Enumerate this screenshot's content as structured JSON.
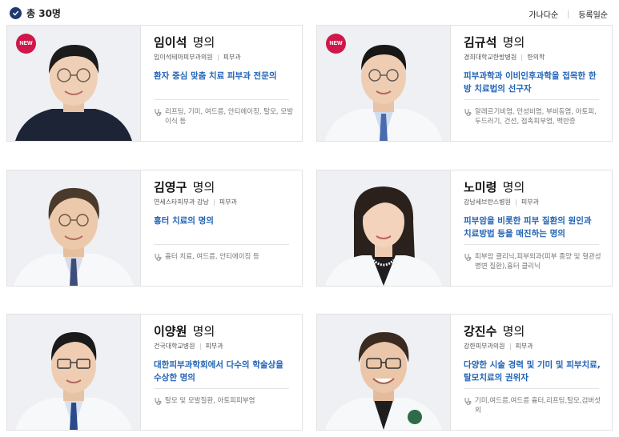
{
  "header": {
    "total_label": "총 30명",
    "sort_options": [
      "가나다순",
      "등록일순"
    ]
  },
  "doctors": [
    {
      "name": "임이석",
      "title": "명의",
      "is_new": true,
      "badge": "NEW",
      "hospital": "임이석테마피부과의원",
      "department": "피부과",
      "headline": "환자 중심 맞춤 치료 피부과 전문의",
      "specialties": "리프팅, 기미, 여드름, 안티에이징, 탈모, 모발이식 등"
    },
    {
      "name": "김규석",
      "title": "명의",
      "is_new": true,
      "badge": "NEW",
      "hospital": "경희대학교한방병원",
      "department": "한의학",
      "headline": "피부과학과 이비인후과학을 접목한 한방 치료법의 선구자",
      "specialties": "알레르기비염, 만성비염, 부비동염, 아토피, 두드러기, 건선, 접촉피부염, 백반증"
    },
    {
      "name": "김영구",
      "title": "명의",
      "is_new": false,
      "badge": "",
      "hospital": "연세스타피부과 강남",
      "department": "피부과",
      "headline": "흉터 치료의 명의",
      "specialties": "흉터 치료, 여드름, 안티에이징 등"
    },
    {
      "name": "노미령",
      "title": "명의",
      "is_new": false,
      "badge": "",
      "hospital": "강남세브란스병원",
      "department": "피부과",
      "headline": "피부암을 비롯한 피부 질환의 원인과 치료방법 등을 매진하는 명의",
      "specialties": "피부암 클리닉,피부외과(피부 종양 및 혈관성 병변 질환),흉터 클리닉"
    },
    {
      "name": "이양원",
      "title": "명의",
      "is_new": false,
      "badge": "",
      "hospital": "건국대학교병원",
      "department": "피부과",
      "headline": "대한피부과학회에서 다수의 학술상을 수상한 명의",
      "specialties": "탈모 및 모발질환, 아토피피부염"
    },
    {
      "name": "강진수",
      "title": "명의",
      "is_new": false,
      "badge": "",
      "hospital": "강한피부과의원",
      "department": "피부과",
      "headline": "다양한 시술 경력 및 기미 및 피부치료, 탈모치료의 권위자",
      "specialties": "기미,여드름,여드름 흉터,리프팅,탈모,검버섯 외"
    }
  ],
  "colors": {
    "accent_blue": "#1f62b5",
    "new_badge": "#d0174a",
    "check_icon": "#1f3a6e"
  }
}
